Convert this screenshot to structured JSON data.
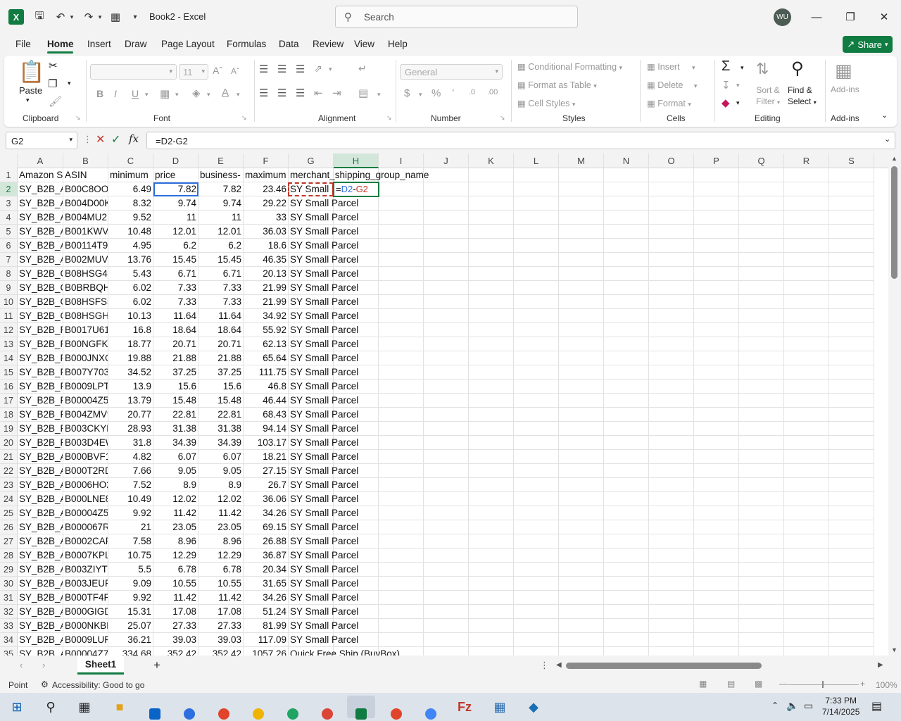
{
  "titlebar": {
    "doc_title": "Book2  -  Excel",
    "search_placeholder": "Search",
    "avatar_initials": "WU",
    "logo": "X"
  },
  "ribbon_tabs": [
    "File",
    "Home",
    "Insert",
    "Draw",
    "Page Layout",
    "Formulas",
    "Data",
    "Review",
    "View",
    "Help"
  ],
  "share_label": "Share",
  "ribbon": {
    "clipboard": {
      "paste": "Paste",
      "label": "Clipboard"
    },
    "font": {
      "label": "Font",
      "size": "11"
    },
    "alignment": {
      "label": "Alignment"
    },
    "number": {
      "label": "Number",
      "format": "General"
    },
    "styles": {
      "label": "Styles",
      "conditional": "Conditional Formatting",
      "table": "Format as Table",
      "cell_styles": "Cell Styles"
    },
    "cells": {
      "label": "Cells",
      "insert": "Insert",
      "delete": "Delete",
      "format": "Format"
    },
    "editing": {
      "label": "Editing",
      "sort": "Sort &",
      "filter": "Filter",
      "find": "Find &",
      "select": "Select"
    },
    "addins": {
      "label": "Add-ins",
      "button": "Add-ins"
    }
  },
  "formula_bar": {
    "name_box": "G2",
    "formula": "=D2-G2"
  },
  "columns": [
    "A",
    "B",
    "C",
    "D",
    "E",
    "F",
    "G",
    "H",
    "I",
    "J",
    "K",
    "L",
    "M",
    "N",
    "O",
    "P",
    "Q",
    "R",
    "S"
  ],
  "headers": [
    "Amazon S",
    "ASIN",
    "minimum",
    "price",
    "business-",
    "maximum",
    "merchant_shipping_group_name"
  ],
  "rows": [
    [
      "SY_B2B_A",
      "B00C8OOE",
      "6.49",
      "7.82",
      "7.82",
      "23.46",
      "SY Small P"
    ],
    [
      "SY_B2B_A",
      "B004D00K",
      "8.32",
      "9.74",
      "9.74",
      "29.22",
      "SY Small Parcel"
    ],
    [
      "SY_B2B_A",
      "B004MU2E",
      "9.52",
      "11",
      "11",
      "33",
      "SY Small Parcel"
    ],
    [
      "SY_B2B_A",
      "B001KWV!",
      "10.48",
      "12.01",
      "12.01",
      "36.03",
      "SY Small Parcel"
    ],
    [
      "SY_B2B_A",
      "B00114T9Y",
      "4.95",
      "6.2",
      "6.2",
      "18.6",
      "SY Small Parcel"
    ],
    [
      "SY_B2B_A",
      "B002MUV.",
      "13.76",
      "15.45",
      "15.45",
      "46.35",
      "SY Small Parcel"
    ],
    [
      "SY_B2B_CI",
      "B08HSG4J",
      "5.43",
      "6.71",
      "6.71",
      "20.13",
      "SY Small Parcel"
    ],
    [
      "SY_B2B_CI",
      "B0BRBQHY",
      "6.02",
      "7.33",
      "7.33",
      "21.99",
      "SY Small Parcel"
    ],
    [
      "SY_B2B_CI",
      "B08HSFS5",
      "6.02",
      "7.33",
      "7.33",
      "21.99",
      "SY Small Parcel"
    ],
    [
      "SY_B2B_CI",
      "B08HSGHF",
      "10.13",
      "11.64",
      "11.64",
      "34.92",
      "SY Small Parcel"
    ],
    [
      "SY_B2B_F",
      "B0017U61I",
      "16.8",
      "18.64",
      "18.64",
      "55.92",
      "SY Small Parcel"
    ],
    [
      "SY_B2B_F",
      "B00NGFKY",
      "18.77",
      "20.71",
      "20.71",
      "62.13",
      "SY Small Parcel"
    ],
    [
      "SY_B2B_F",
      "B000JNXC",
      "19.88",
      "21.88",
      "21.88",
      "65.64",
      "SY Small Parcel"
    ],
    [
      "SY_B2B_F",
      "B007Y703\\",
      "34.52",
      "37.25",
      "37.25",
      "111.75",
      "SY Small Parcel"
    ],
    [
      "SY_B2B_F",
      "B0009LPT/",
      "13.9",
      "15.6",
      "15.6",
      "46.8",
      "SY Small Parcel"
    ],
    [
      "SY_B2B_F",
      "B00004Z5(",
      "13.79",
      "15.48",
      "15.48",
      "46.44",
      "SY Small Parcel"
    ],
    [
      "SY_B2B_F",
      "B004ZMV9",
      "20.77",
      "22.81",
      "22.81",
      "68.43",
      "SY Small Parcel"
    ],
    [
      "SY_B2B_F",
      "B003CKYK",
      "28.93",
      "31.38",
      "31.38",
      "94.14",
      "SY Small Parcel"
    ],
    [
      "SY_B2B_F",
      "B003D4EW",
      "31.8",
      "34.39",
      "34.39",
      "103.17",
      "SY Small Parcel"
    ],
    [
      "SY_B2B_A",
      "B000BVF1",
      "4.82",
      "6.07",
      "6.07",
      "18.21",
      "SY Small Parcel"
    ],
    [
      "SY_B2B_A",
      "B000T2RD",
      "7.66",
      "9.05",
      "9.05",
      "27.15",
      "SY Small Parcel"
    ],
    [
      "SY_B2B_A",
      "B0006HO2",
      "7.52",
      "8.9",
      "8.9",
      "26.7",
      "SY Small Parcel"
    ],
    [
      "SY_B2B_A",
      "B000LNE8",
      "10.49",
      "12.02",
      "12.02",
      "36.06",
      "SY Small Parcel"
    ],
    [
      "SY_B2B_A",
      "B00004Z5T",
      "9.92",
      "11.42",
      "11.42",
      "34.26",
      "SY Small Parcel"
    ],
    [
      "SY_B2B_A",
      "B000067RI",
      "21",
      "23.05",
      "23.05",
      "69.15",
      "SY Small Parcel"
    ],
    [
      "SY_B2B_A",
      "B0002CAR",
      "7.58",
      "8.96",
      "8.96",
      "26.88",
      "SY Small Parcel"
    ],
    [
      "SY_B2B_A",
      "B0007KPL",
      "10.75",
      "12.29",
      "12.29",
      "36.87",
      "SY Small Parcel"
    ],
    [
      "SY_B2B_A",
      "B003ZIYTR",
      "5.5",
      "6.78",
      "6.78",
      "20.34",
      "SY Small Parcel"
    ],
    [
      "SY_B2B_A",
      "B003JEUR8",
      "9.09",
      "10.55",
      "10.55",
      "31.65",
      "SY Small Parcel"
    ],
    [
      "SY_B2B_A",
      "B000TF4R",
      "9.92",
      "11.42",
      "11.42",
      "34.26",
      "SY Small Parcel"
    ],
    [
      "SY_B2B_A",
      "B000GIGD",
      "15.31",
      "17.08",
      "17.08",
      "51.24",
      "SY Small Parcel"
    ],
    [
      "SY_B2B_A",
      "B000NKBE",
      "25.07",
      "27.33",
      "27.33",
      "81.99",
      "SY Small Parcel"
    ],
    [
      "SY_B2B_A",
      "B0009LUF",
      "36.21",
      "39.03",
      "39.03",
      "117.09",
      "SY Small Parcel"
    ],
    [
      "SY_B2B_A",
      "B00004Z7I",
      "334.68",
      "352.42",
      "352.42",
      "1057.26",
      "Quick Free Ship (BuyBox)"
    ]
  ],
  "editing_cell": {
    "prefix": "=",
    "ref1": "D2",
    "op": "-",
    "ref2": "G2"
  },
  "sheet_tab": "Sheet1",
  "status": {
    "mode": "Point",
    "accessibility": "Accessibility: Good to go",
    "zoom": "100%"
  },
  "clock": {
    "time": "7:33 PM",
    "date": "7/14/2025"
  },
  "colors": {
    "excel_green": "#107c41",
    "ref_blue": "#2f6fdc",
    "ref_red": "#c0392b"
  }
}
